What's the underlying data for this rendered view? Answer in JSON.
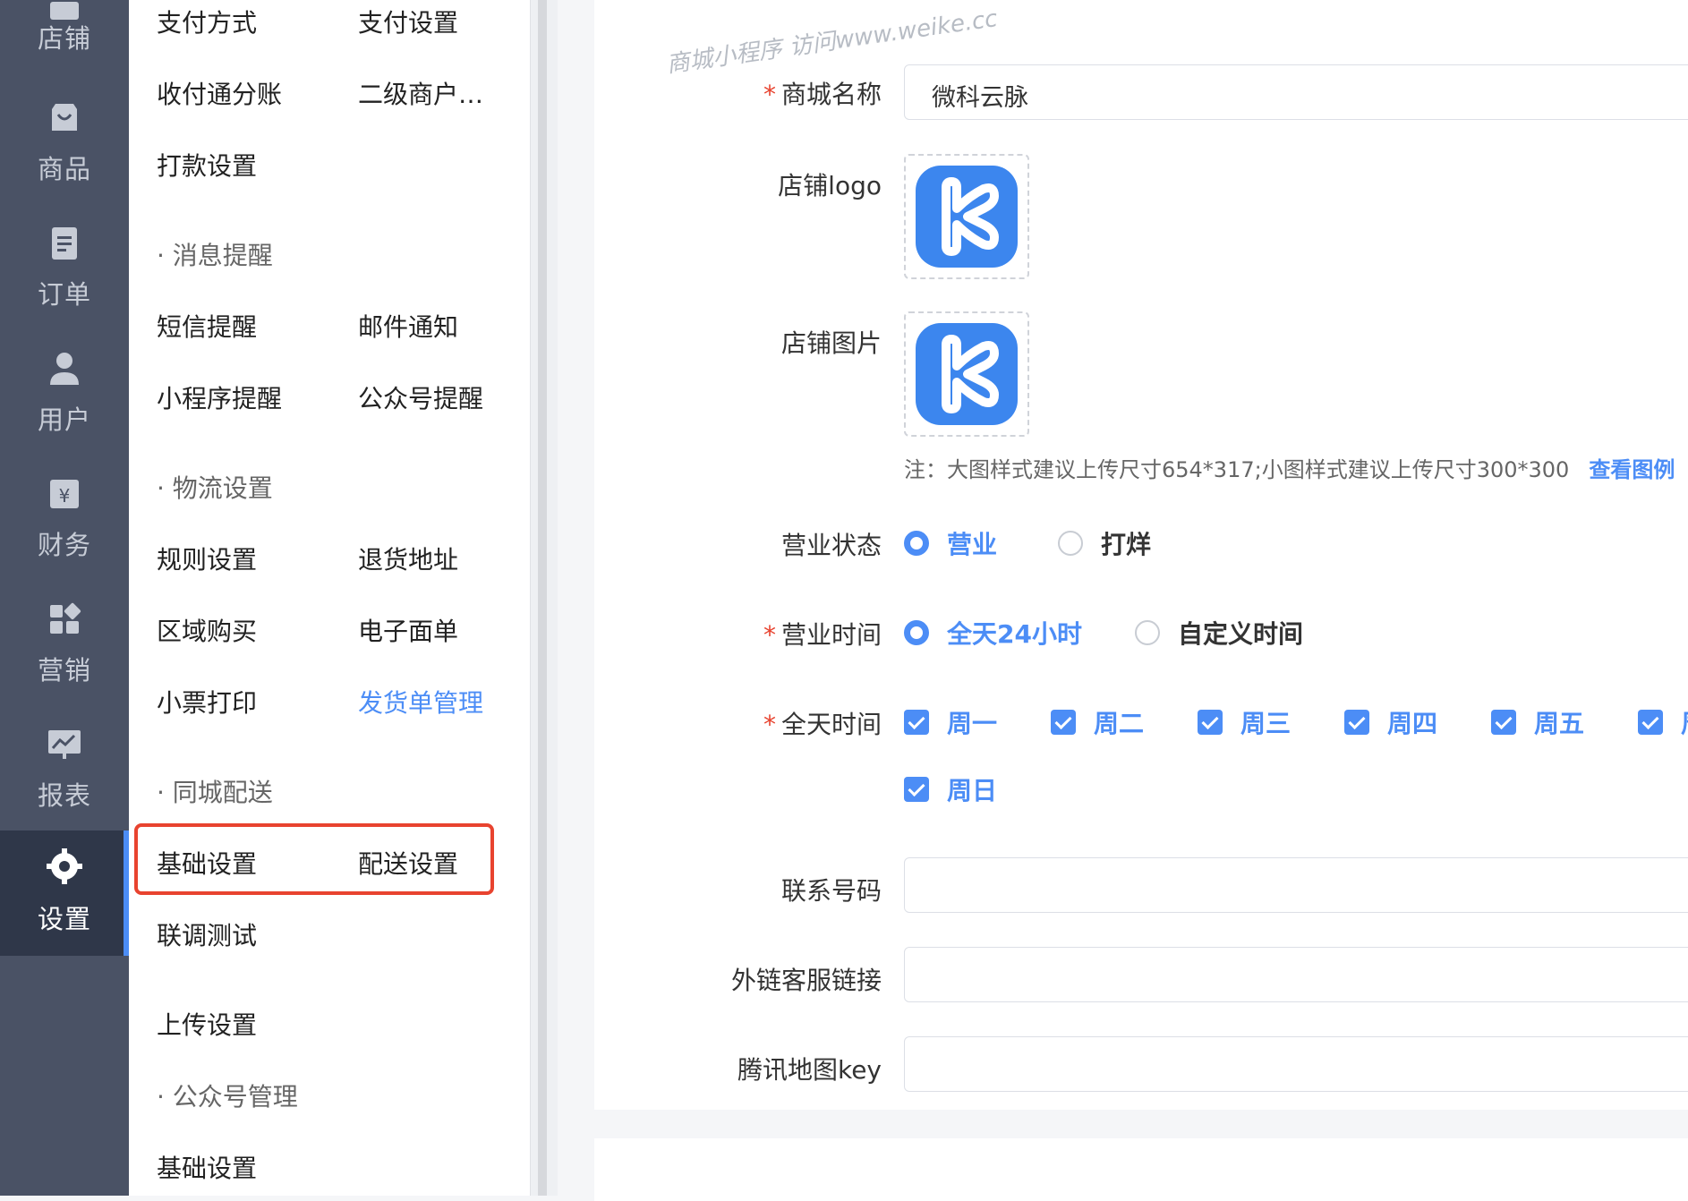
{
  "rail": {
    "items": [
      {
        "label": "店铺",
        "icon": "store-icon"
      },
      {
        "label": "商品",
        "icon": "shopping-bag-icon"
      },
      {
        "label": "订单",
        "icon": "document-icon"
      },
      {
        "label": "用户",
        "icon": "user-icon"
      },
      {
        "label": "财务",
        "icon": "finance-icon"
      },
      {
        "label": "营销",
        "icon": "grid-icon"
      },
      {
        "label": "报表",
        "icon": "chart-icon"
      },
      {
        "label": "设置",
        "icon": "gear-icon",
        "active": true
      }
    ]
  },
  "submenu": {
    "payment_method": "支付方式",
    "payment_settings": "支付设置",
    "split_payment": "收付通分账",
    "secondary_merchant": "二级商户…",
    "payout_settings": "打款设置",
    "group_message": "· 消息提醒",
    "sms_reminder": "短信提醒",
    "email_notice": "邮件通知",
    "miniapp_reminder": "小程序提醒",
    "official_account_reminder": "公众号提醒",
    "group_logistics": "· 物流设置",
    "rule_settings": "规则设置",
    "return_address": "退货地址",
    "area_purchase": "区域购买",
    "e_waybill": "电子面单",
    "receipt_print": "小票打印",
    "delivery_note": "发货单管理",
    "group_city": "· 同城配送",
    "basic_settings": "基础设置",
    "delivery_settings": "配送设置",
    "joint_test": "联调测试",
    "upload_settings": "上传设置",
    "group_official": "· 公众号管理",
    "official_basic": "基础设置"
  },
  "form": {
    "watermark": "商城小程序 访问www.weike.cc",
    "shop_name_label": "商城名称",
    "shop_name_value": "微科云脉",
    "shop_logo_label": "店铺logo",
    "shop_image_label": "店铺图片",
    "note_text": "注：大图样式建议上传尺寸654*317;小图样式建议上传尺寸300*300",
    "note_link": "查看图例",
    "status_label": "营业状态",
    "status_open": "营业",
    "status_closed": "打烊",
    "hours_label": "营业时间",
    "hours_allday": "全天24小时",
    "hours_custom": "自定义时间",
    "days_label": "全天时间",
    "days": [
      "周一",
      "周二",
      "周三",
      "周四",
      "周五",
      "周"
    ],
    "sunday": "周日",
    "phone_label": "联系号码",
    "external_cs_label": "外链客服链接",
    "map_key_label": "腾讯地图key"
  },
  "colors": {
    "rail_bg": "#4a5265",
    "rail_active": "#2f3749",
    "accent": "#4c8df6",
    "highlight": "#e8432f"
  }
}
